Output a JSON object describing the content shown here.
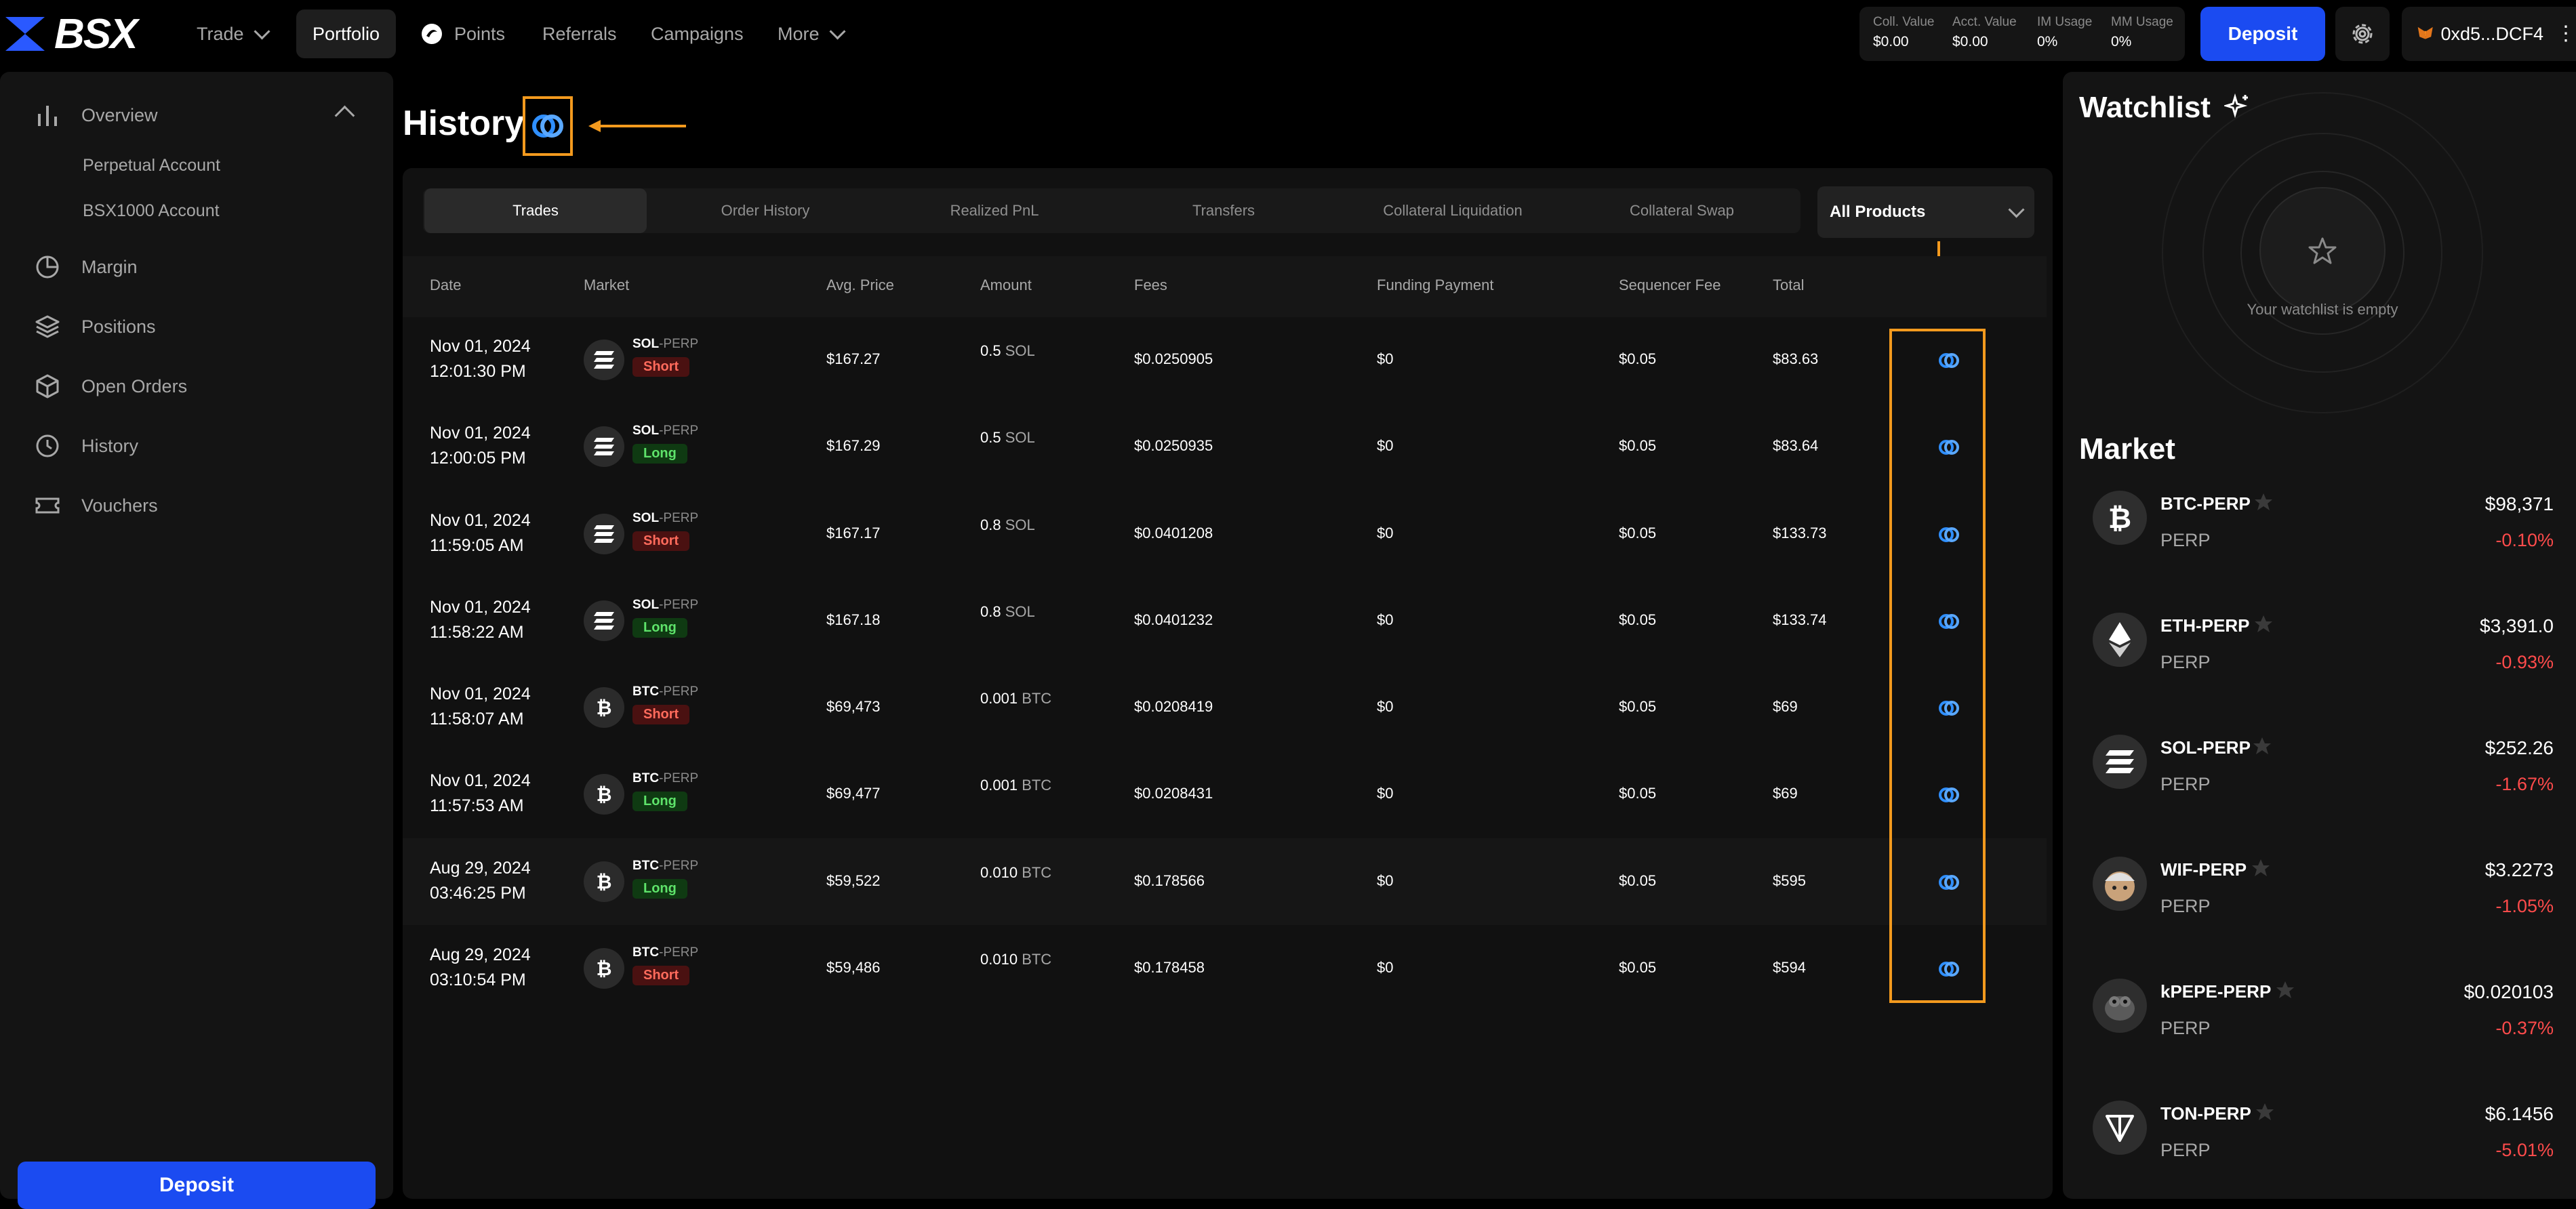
{
  "brand": {
    "logo_text": "BSX"
  },
  "nav": {
    "trade": "Trade",
    "portfolio": "Portfolio",
    "points": "Points",
    "referrals": "Referrals",
    "campaigns": "Campaigns",
    "more": "More"
  },
  "stats": [
    {
      "label": "Coll. Value",
      "value": "$0.00"
    },
    {
      "label": "Acct. Value",
      "value": "$0.00"
    },
    {
      "label": "IM Usage",
      "value": "0%"
    },
    {
      "label": "MM Usage",
      "value": "0%"
    }
  ],
  "header": {
    "deposit": "Deposit",
    "wallet": "0xd5...DCF4"
  },
  "sidebar": {
    "overview": "Overview",
    "perpetual_account": "Perpetual Account",
    "bsx1000_account": "BSX1000 Account",
    "margin": "Margin",
    "positions": "Positions",
    "open_orders": "Open Orders",
    "history": "History",
    "vouchers": "Vouchers",
    "deposit": "Deposit"
  },
  "history": {
    "title": "History",
    "tabs": [
      "Trades",
      "Order History",
      "Realized PnL",
      "Transfers",
      "Collateral Liquidation",
      "Collateral Swap"
    ],
    "products": "All Products",
    "columns": [
      "Date",
      "Market",
      "Avg. Price",
      "Amount",
      "Fees",
      "Funding Payment",
      "Sequencer Fee",
      "Total"
    ],
    "rows": [
      {
        "date": "Nov 01, 2024",
        "time": "12:01:30 PM",
        "asset": "SOL",
        "suffix": "-PERP",
        "side": "Short",
        "price": "$167.27",
        "amount": "0.5",
        "unit": "SOL",
        "fees": "$0.0250905",
        "funding": "$0",
        "seq": "$0.05",
        "total": "$83.63"
      },
      {
        "date": "Nov 01, 2024",
        "time": "12:00:05 PM",
        "asset": "SOL",
        "suffix": "-PERP",
        "side": "Long",
        "price": "$167.29",
        "amount": "0.5",
        "unit": "SOL",
        "fees": "$0.0250935",
        "funding": "$0",
        "seq": "$0.05",
        "total": "$83.64"
      },
      {
        "date": "Nov 01, 2024",
        "time": "11:59:05 AM",
        "asset": "SOL",
        "suffix": "-PERP",
        "side": "Short",
        "price": "$167.17",
        "amount": "0.8",
        "unit": "SOL",
        "fees": "$0.0401208",
        "funding": "$0",
        "seq": "$0.05",
        "total": "$133.73"
      },
      {
        "date": "Nov 01, 2024",
        "time": "11:58:22 AM",
        "asset": "SOL",
        "suffix": "-PERP",
        "side": "Long",
        "price": "$167.18",
        "amount": "0.8",
        "unit": "SOL",
        "fees": "$0.0401232",
        "funding": "$0",
        "seq": "$0.05",
        "total": "$133.74"
      },
      {
        "date": "Nov 01, 2024",
        "time": "11:58:07 AM",
        "asset": "BTC",
        "suffix": "-PERP",
        "side": "Short",
        "price": "$69,473",
        "amount": "0.001",
        "unit": "BTC",
        "fees": "$0.0208419",
        "funding": "$0",
        "seq": "$0.05",
        "total": "$69"
      },
      {
        "date": "Nov 01, 2024",
        "time": "11:57:53 AM",
        "asset": "BTC",
        "suffix": "-PERP",
        "side": "Long",
        "price": "$69,477",
        "amount": "0.001",
        "unit": "BTC",
        "fees": "$0.0208431",
        "funding": "$0",
        "seq": "$0.05",
        "total": "$69"
      },
      {
        "date": "Aug 29, 2024",
        "time": "03:46:25 PM",
        "asset": "BTC",
        "suffix": "-PERP",
        "side": "Long",
        "price": "$59,522",
        "amount": "0.010",
        "unit": "BTC",
        "fees": "$0.178566",
        "funding": "$0",
        "seq": "$0.05",
        "total": "$595"
      },
      {
        "date": "Aug 29, 2024",
        "time": "03:10:54 PM",
        "asset": "BTC",
        "suffix": "-PERP",
        "side": "Short",
        "price": "$59,486",
        "amount": "0.010",
        "unit": "BTC",
        "fees": "$0.178458",
        "funding": "$0",
        "seq": "$0.05",
        "total": "$594"
      }
    ]
  },
  "watchlist": {
    "title": "Watchlist",
    "empty": "Your watchlist is empty"
  },
  "market": {
    "title": "Market",
    "items": [
      {
        "name": "BTC-PERP",
        "sub": "PERP",
        "price": "$98,371",
        "change": "-0.10%",
        "icon": "btc-icon"
      },
      {
        "name": "ETH-PERP",
        "sub": "PERP",
        "price": "$3,391.0",
        "change": "-0.93%",
        "icon": "eth-icon"
      },
      {
        "name": "SOL-PERP",
        "sub": "PERP",
        "price": "$252.26",
        "change": "-1.67%",
        "icon": "sol-icon"
      },
      {
        "name": "WIF-PERP",
        "sub": "PERP",
        "price": "$3.2273",
        "change": "-1.05%",
        "icon": "wif-icon"
      },
      {
        "name": "kPEPE-PERP",
        "sub": "PERP",
        "price": "$0.020103",
        "change": "-0.37%",
        "icon": "pepe-icon"
      },
      {
        "name": "TON-PERP",
        "sub": "PERP",
        "price": "$6.1456",
        "change": "-5.01%",
        "icon": "ton-icon"
      }
    ]
  },
  "colors": {
    "accent": "#1b4bf1",
    "annotation": "#f39a1e",
    "short": "#ff6b5c",
    "long": "#5ee36a",
    "negative": "#ff4b4b",
    "link_icon": "#2f8fff"
  }
}
